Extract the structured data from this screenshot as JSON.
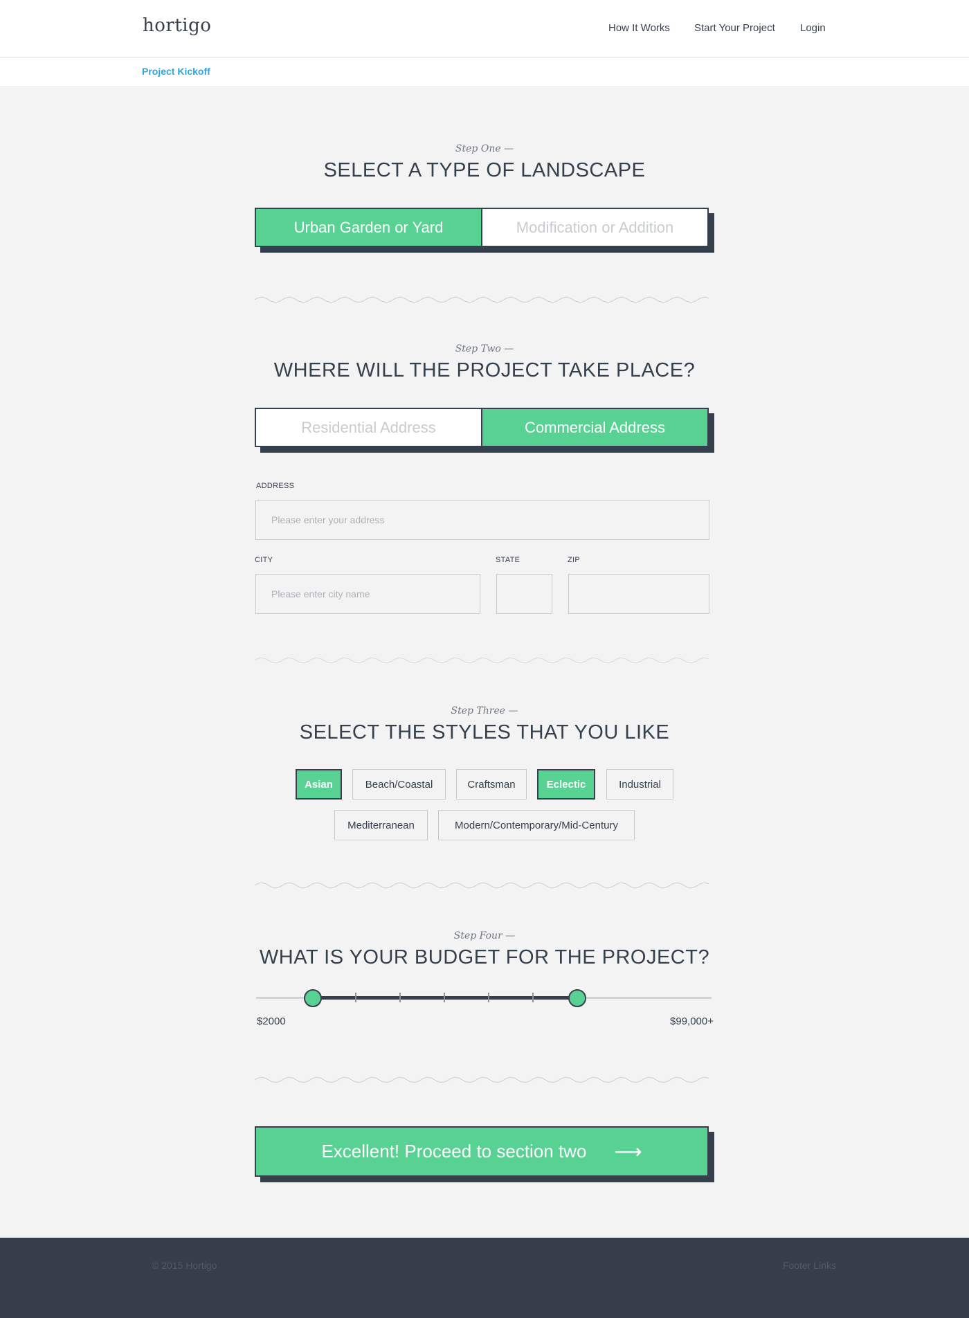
{
  "header": {
    "logo": "hortigo",
    "nav": [
      "How It Works",
      "Start Your Project",
      "Login"
    ]
  },
  "breadcrumb": "Project Kickoff",
  "step1": {
    "label": "Step One —",
    "title": "SELECT A TYPE OF LANDSCAPE",
    "options": [
      "Urban Garden or Yard",
      "Modification or Addition"
    ],
    "selected": "Urban Garden or Yard"
  },
  "step2": {
    "label": "Step Two —",
    "title": "WHERE WILL THE PROJECT TAKE PLACE?",
    "options": [
      "Residential Address",
      "Commercial Address"
    ],
    "selected": "Commercial Address",
    "address_label": "ADDRESS",
    "address_placeholder": "Please enter your address",
    "city_label": "CITY",
    "city_placeholder": "Please enter city name",
    "state_label": "STATE",
    "zip_label": "ZIP"
  },
  "step3": {
    "label": "Step Three —",
    "title": "SELECT THE STYLES THAT YOU LIKE",
    "styles": [
      "Asian",
      "Beach/Coastal",
      "Craftsman",
      "Eclectic",
      "Industrial",
      "Mediterranean",
      "Modern/Contemporary/Mid-Century"
    ],
    "selected": [
      "Asian",
      "Eclectic"
    ]
  },
  "step4": {
    "label": "Step Four —",
    "title": "WHAT IS YOUR BUDGET FOR THE PROJECT?",
    "min_label": "$2000",
    "max_label": "$99,000+",
    "low_fraction": 0.125,
    "high_fraction": 0.705
  },
  "cta": {
    "label": "Excellent! Proceed to section two",
    "arrow": "⟶"
  },
  "footer": {
    "copyright": "© 2015 Hortigo",
    "links": "Footer Links"
  },
  "colors": {
    "accent": "#58d293",
    "dark": "#36404d",
    "link": "#2ba7e0",
    "footer": "#373d4a"
  }
}
